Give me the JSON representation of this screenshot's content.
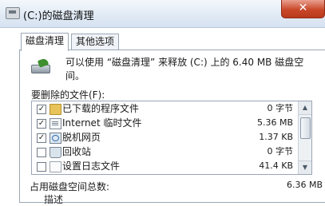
{
  "window": {
    "title": "(C:)的磁盘清理",
    "close_glyph": "✕",
    "icon": "drive-icon"
  },
  "tabs": [
    {
      "label": "磁盘清理",
      "active": true
    },
    {
      "label": "其他选项",
      "active": false
    }
  ],
  "main": {
    "description": "可以使用 “磁盘清理” 来释放 (C:) 上的 6.40 MB 磁盘空间。",
    "files_label": "要删除的文件(F):",
    "files": [
      {
        "checked": true,
        "icon": "folder-icon",
        "name": "已下载的程序文件",
        "size": "0 字节"
      },
      {
        "checked": true,
        "icon": "doc-icon",
        "name": "Internet 临时文件",
        "size": "5.36 MB"
      },
      {
        "checked": true,
        "icon": "web-icon",
        "name": "脱机网页",
        "size": "1.37 KB"
      },
      {
        "checked": false,
        "icon": "bin-icon",
        "name": "回收站",
        "size": "0 字节"
      },
      {
        "checked": false,
        "icon": "log-icon",
        "name": "设置日志文件",
        "size": "41.4 KB"
      }
    ],
    "total_label": "占用磁盘空间总数:",
    "total_value": "6.36 MB",
    "description_section_label": "描述"
  },
  "colors": {
    "titlebar": "#dfe9f4",
    "close_button": "#c9482a",
    "border": "#9aa7b5"
  }
}
